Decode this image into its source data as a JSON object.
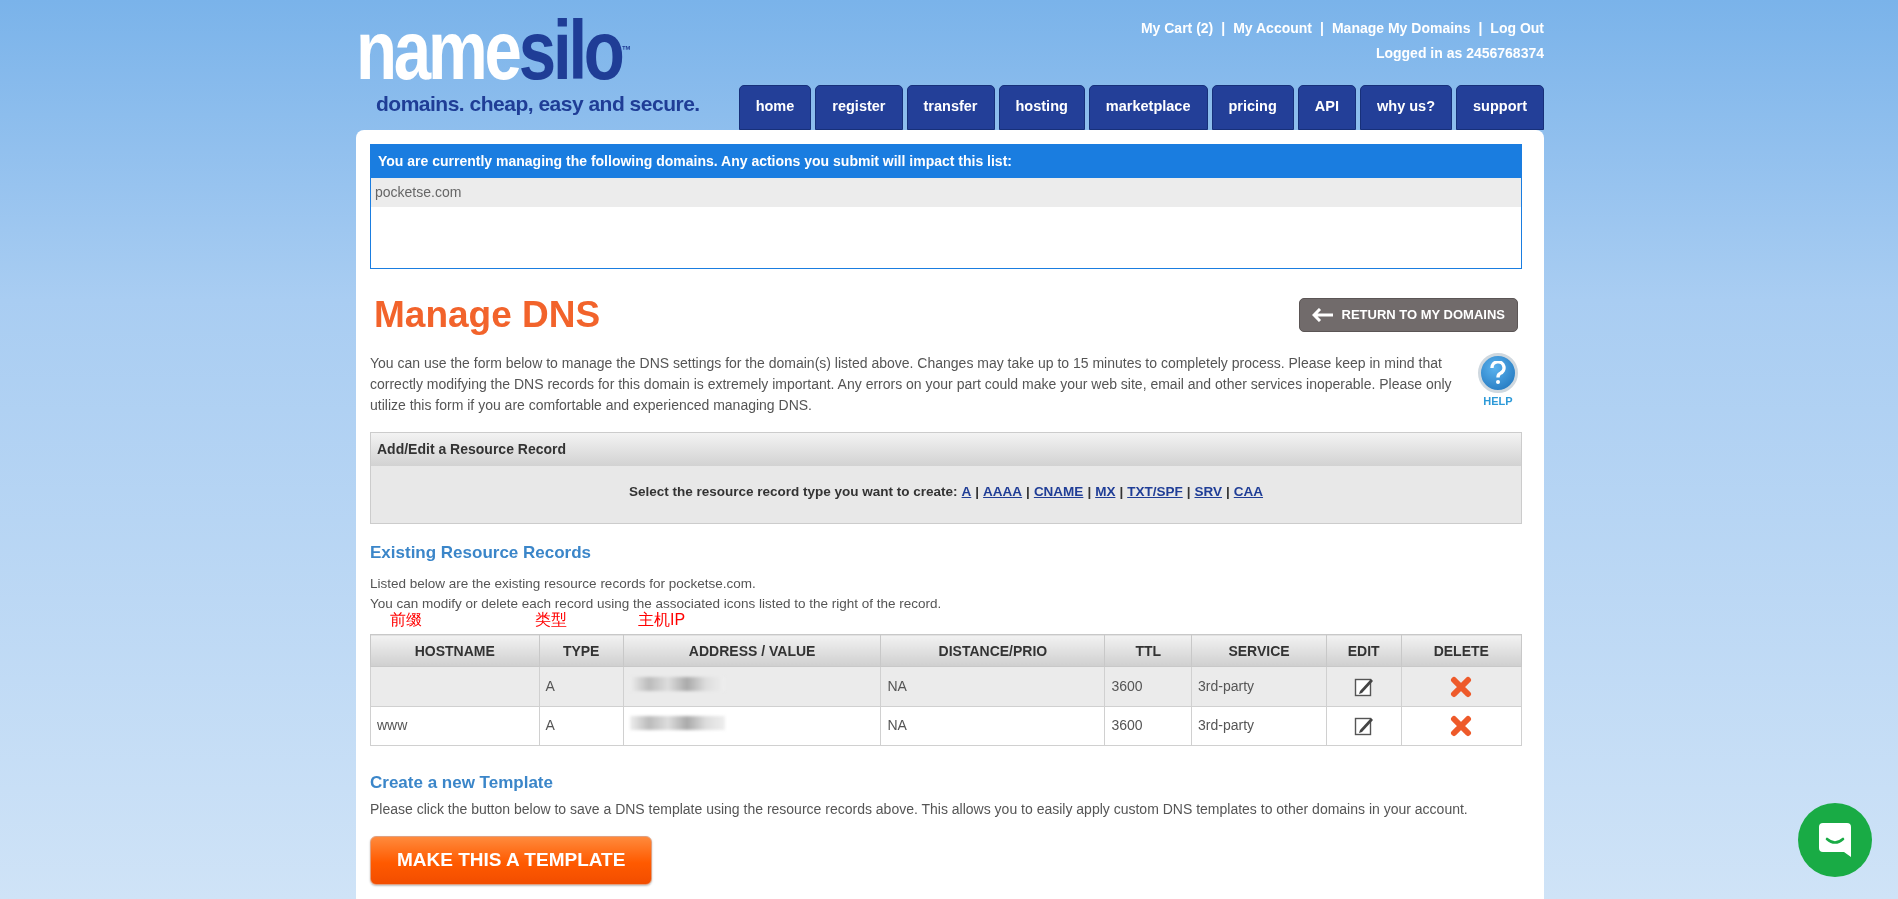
{
  "logo": {
    "name_part1": "name",
    "name_part2": "silo",
    "trademark": "™",
    "tagline": "domains. cheap, easy and secure."
  },
  "top_links": [
    {
      "label": "My Cart (2)"
    },
    {
      "label": "My Account"
    },
    {
      "label": "Manage My Domains"
    },
    {
      "label": "Log Out"
    }
  ],
  "separator": "|",
  "logged_in": "Logged in as 2456768374",
  "nav": [
    {
      "label": "home"
    },
    {
      "label": "register"
    },
    {
      "label": "transfer"
    },
    {
      "label": "hosting"
    },
    {
      "label": "marketplace"
    },
    {
      "label": "pricing"
    },
    {
      "label": "API"
    },
    {
      "label": "why us?"
    },
    {
      "label": "support"
    }
  ],
  "managing": {
    "header": "You are currently managing the following domains. Any actions you submit will impact this list:",
    "domains": [
      "pocketse.com"
    ]
  },
  "title": "Manage DNS",
  "return_button": "RETURN TO MY DOMAINS",
  "intro": "You can use the form below to manage the DNS settings for the domain(s) listed above. Changes may take up to 15 minutes to completely process. Please keep in mind that correctly modifying the DNS records for this domain is extremely important. Any errors on your part could make your web site, email and other services inoperable. Please only utilize this form if you are comfortable and experienced managing DNS.",
  "help": "HELP",
  "add_edit": {
    "header": "Add/Edit a Resource Record",
    "prompt": "Select the resource record type you want to create:",
    "types": [
      "A",
      "AAAA",
      "CNAME",
      "MX",
      "TXT/SPF",
      "SRV",
      "CAA"
    ]
  },
  "existing": {
    "heading": "Existing Resource Records",
    "lines": [
      "Listed below are the existing resource records for pocketse.com.",
      "You can modify or delete each record using the associated icons listed to the right of the record."
    ]
  },
  "annotations": [
    {
      "text": "前缀"
    },
    {
      "text": "类型"
    },
    {
      "text": "主机IP"
    }
  ],
  "table": {
    "columns": [
      "HOSTNAME",
      "TYPE",
      "ADDRESS / VALUE",
      "DISTANCE/PRIO",
      "TTL",
      "SERVICE",
      "EDIT",
      "DELETE"
    ],
    "rows": [
      {
        "hostname": "",
        "type": "A",
        "address_blurred": true,
        "distance": "NA",
        "ttl": "3600",
        "service": "3rd-party"
      },
      {
        "hostname": "www",
        "type": "A",
        "address_blurred": true,
        "distance": "NA",
        "ttl": "3600",
        "service": "3rd-party"
      }
    ]
  },
  "template": {
    "heading": "Create a new Template",
    "text": "Please click the button below to save a DNS template using the resource records above. This allows you to easily apply custom DNS templates to other domains in your account.",
    "button": "MAKE THIS A TEMPLATE"
  }
}
